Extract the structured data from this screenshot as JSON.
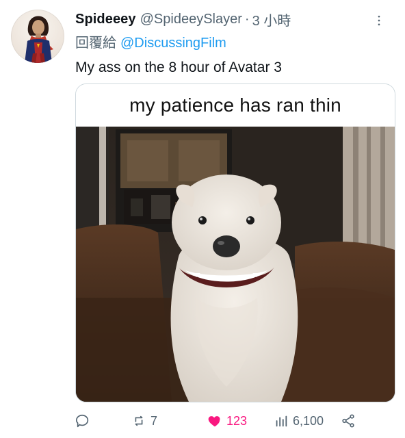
{
  "tweet": {
    "author": {
      "display_name": "Spideeey",
      "handle": "@SpideeySlayer",
      "separator": "·",
      "time": "3 小時",
      "avatar_icon": "avatar-icon"
    },
    "reply": {
      "prefix": "回覆給",
      "to": "@DiscussingFilm"
    },
    "text": "My ass on the 8 hour of Avatar 3",
    "media": {
      "caption": "my patience has ran thin",
      "image_icon": "smiling-dog-image"
    },
    "actions": {
      "reply": {
        "icon": "reply-icon",
        "count": ""
      },
      "retweet": {
        "icon": "retweet-icon",
        "count": "7"
      },
      "like": {
        "icon": "heart-icon",
        "count": "123"
      },
      "views": {
        "icon": "views-icon",
        "count": "6,100"
      },
      "share": {
        "icon": "share-icon",
        "count": ""
      }
    }
  },
  "colors": {
    "text_primary": "#0f1419",
    "text_secondary": "#536471",
    "link": "#1d9bf0",
    "like_pink": "#f91880",
    "border": "#cfd9de"
  }
}
